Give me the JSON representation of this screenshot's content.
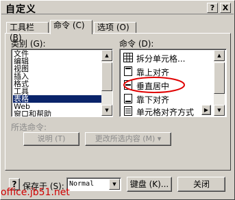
{
  "window": {
    "title": "自定义",
    "help_button": "?",
    "close_button": "X"
  },
  "tabs": [
    {
      "label": "工具栏 (B)"
    },
    {
      "label": "命令 (C)"
    },
    {
      "label": "选项 (O)"
    }
  ],
  "categories": {
    "label": "类别 (G):",
    "items": [
      "文件",
      "编辑",
      "视图",
      "插入",
      "格式",
      "工具",
      "表格",
      "Web",
      "窗口和帮助"
    ],
    "selected": "表格"
  },
  "commands": {
    "label": "命令 (D):",
    "items": [
      {
        "label": "拆分单元格...",
        "icon": "split-cells-icon"
      },
      {
        "label": "靠上对齐",
        "icon": "align-top-icon"
      },
      {
        "label": "垂直居中",
        "icon": "center-vertically-icon",
        "highlighted": true
      },
      {
        "label": "靠下对齐",
        "icon": "align-bottom-icon"
      },
      {
        "label": "单元格对齐方式",
        "icon": "cell-alignment-icon",
        "has_submenu": true
      }
    ]
  },
  "selected_command": {
    "label": "所选命令:",
    "describe_button": "说明 (T)",
    "modify_button": "更改所选内容 (M) ▾"
  },
  "footer": {
    "help_icon": "?",
    "save_in_label": "保存于 (S):",
    "save_in_value": "Normal",
    "keyboard_button": "键盘 (K)...",
    "close_button": "关闭"
  },
  "watermark": "office.jb51.net",
  "colors": {
    "dialog_bg": "#d4d0c8",
    "selection": "#0a246a",
    "highlight_circle": "#e00000",
    "watermark": "#d00000"
  }
}
